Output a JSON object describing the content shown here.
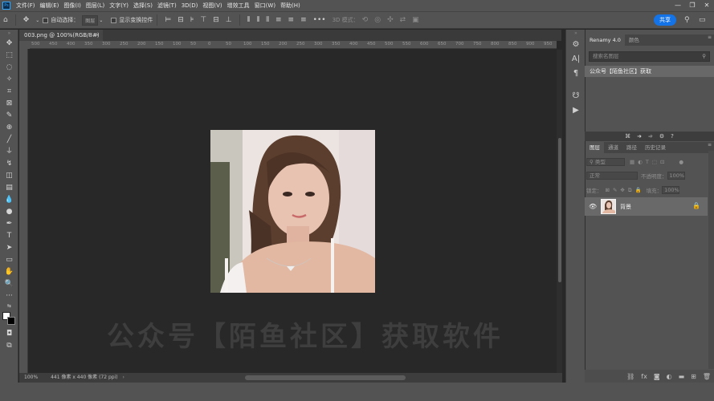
{
  "app": {
    "logo": "Ps"
  },
  "menu": [
    "文件(F)",
    "编辑(E)",
    "图像(I)",
    "图层(L)",
    "文字(Y)",
    "选择(S)",
    "滤镜(T)",
    "3D(D)",
    "视图(V)",
    "增效工具",
    "窗口(W)",
    "帮助(H)"
  ],
  "options": {
    "auto_select_label": "自动选择：",
    "auto_select_value": "图层",
    "show_transform_label": "显示变换控件",
    "mode_3d_label": "3D 模式：",
    "share_label": "共享"
  },
  "document": {
    "tab_title": "003.png @ 100%(RGB/8#) *",
    "zoom": "100%",
    "info": "441 像素 x 440 像素 (72 ppi)"
  },
  "ruler_ticks": [
    "500",
    "450",
    "400",
    "350",
    "300",
    "250",
    "200",
    "150",
    "100",
    "50",
    "0",
    "50",
    "100",
    "150",
    "200",
    "250",
    "300",
    "350",
    "400",
    "450",
    "500",
    "550",
    "600",
    "650",
    "700",
    "750",
    "800",
    "850",
    "900",
    "950"
  ],
  "watermark": "公众号【陌鱼社区】获取软件",
  "right_panel": {
    "tabs": [
      "Renamy 4.0",
      "颜色"
    ],
    "search_placeholder": "搜索名图层",
    "message": "公众号【陌鱼社区】获取",
    "layers_tabs": [
      "图层",
      "通道",
      "路径",
      "历史记录"
    ],
    "filter_label": "类型",
    "blend_mode": "正常",
    "opacity_label": "不透明度：",
    "opacity_value": "100%",
    "lock_label": "锁定：",
    "fill_label": "填充：",
    "fill_value": "100%",
    "layer_name": "背景"
  },
  "colors": {
    "accent": "#1473e6",
    "panel": "#535353",
    "canvas": "#282828"
  }
}
